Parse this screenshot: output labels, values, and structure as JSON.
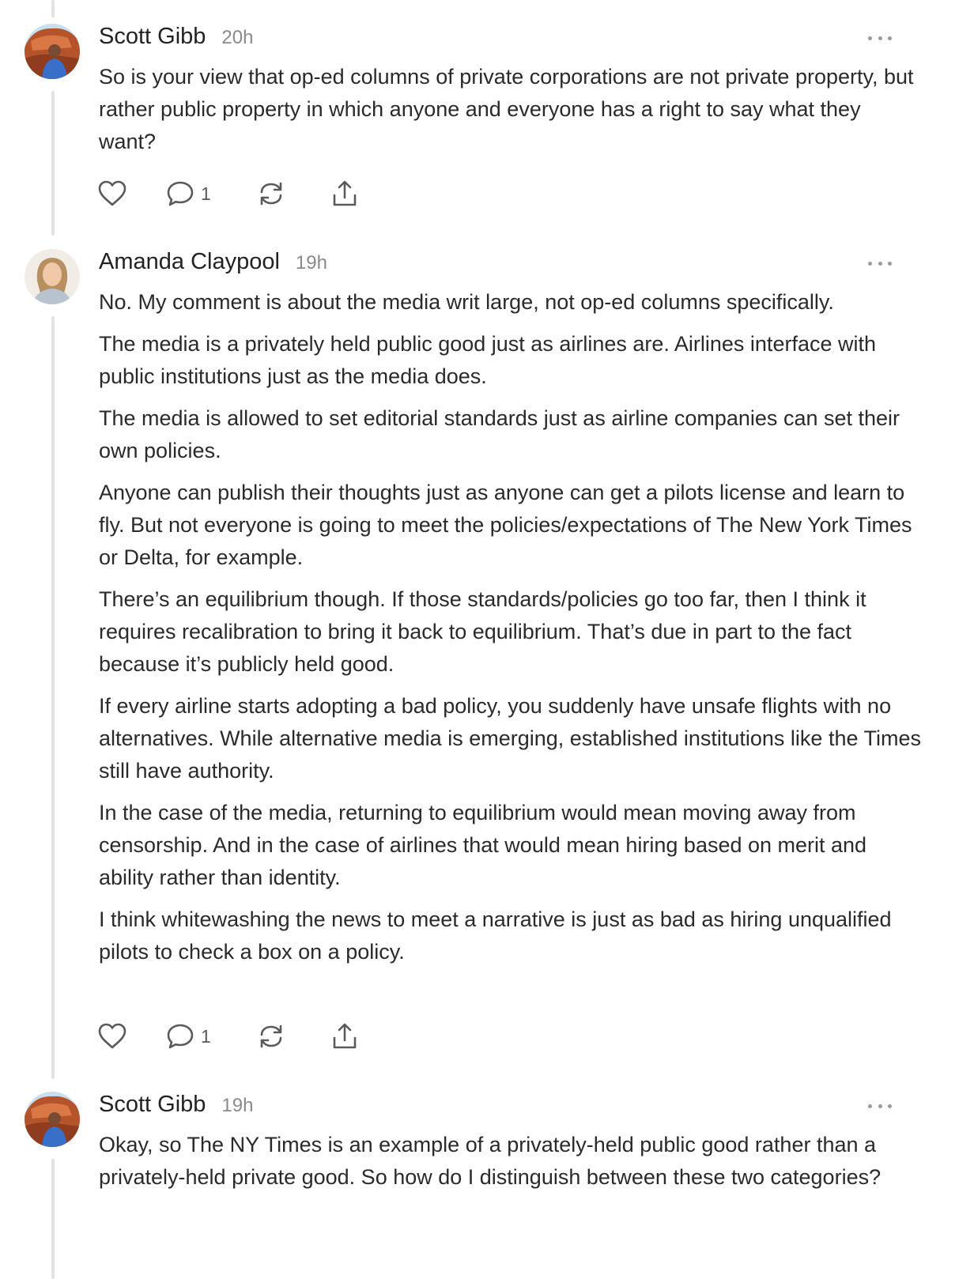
{
  "comments": [
    {
      "author": "Scott Gibb",
      "time": "20h",
      "avatar_icon": "profile-photo",
      "paragraphs": [
        "So is your view that op-ed columns of private corporations are not private property, but rather public property in which anyone and everyone has a right to say what they want?"
      ],
      "reply_count": "1"
    },
    {
      "author": "Amanda Claypool",
      "time": "19h",
      "avatar_icon": "profile-photo",
      "paragraphs": [
        "No. My comment is about the media writ large, not op-ed columns specifically.",
        "The media is a privately held public good just as airlines are. Airlines interface with public institutions just as the media does.",
        "The media is allowed to set editorial standards just as airline companies can set their own policies.",
        "Anyone can publish their thoughts just as anyone can get a pilots license and learn to fly. But not everyone is going to meet the policies/expectations of The New York Times or Delta, for example.",
        "There’s an equilibrium though. If those standards/policies go too far, then I think it requires recalibration to bring it back to equilibrium. That’s due in part to the fact because it’s publicly held good.",
        "If every airline starts adopting a bad policy, you suddenly have unsafe flights with no alternatives. While alternative media is emerging, established institutions like the Times still have authority.",
        "In the case of the media, returning to equilibrium would mean moving away from censorship. And in the case of airlines that would mean hiring based on merit and ability rather than identity.",
        "I think whitewashing the news to meet a narrative is just as bad as hiring unqualified pilots to check a box on a policy."
      ],
      "reply_count": "1"
    },
    {
      "author": "Scott Gibb",
      "time": "19h",
      "avatar_icon": "profile-photo",
      "paragraphs": [
        "Okay, so The NY Times is an example of a privately-held public good rather than a privately-held private good. So how do I distinguish between these two categories?"
      ]
    }
  ],
  "icons": {
    "like": "heart-icon",
    "reply": "comment-bubble-icon",
    "restack": "restack-icon",
    "share": "share-icon",
    "more": "more-options-icon"
  },
  "colors": {
    "thread_line": "#e3e3e3",
    "text": "#2a2a2a",
    "muted": "#8a8a8a",
    "icon": "#5a5a5a"
  }
}
